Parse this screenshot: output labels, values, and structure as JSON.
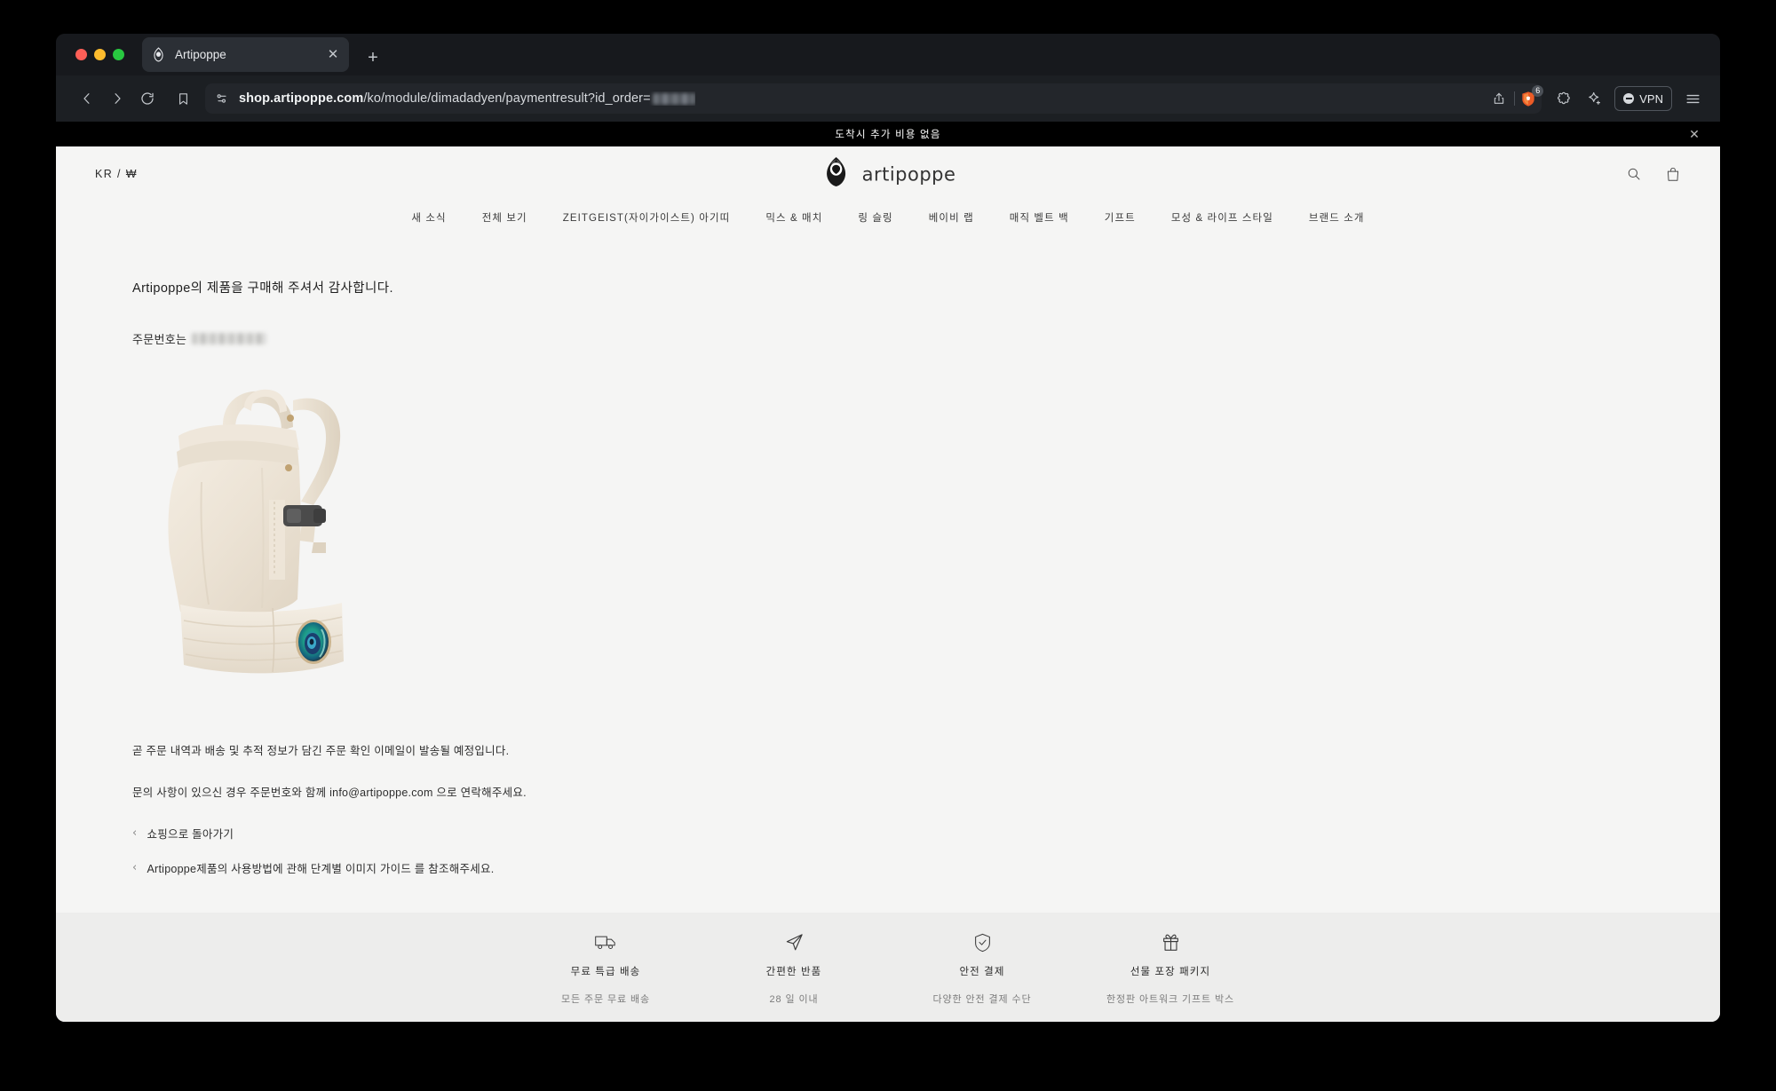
{
  "browser": {
    "tab": {
      "title": "Artipoppe",
      "favicon_icon": "artipoppe-logo-icon",
      "close_icon": "close-icon"
    },
    "new_tab_icon": "plus-icon",
    "nav": {
      "back_icon": "chevron-left-icon",
      "forward_icon": "chevron-right-icon",
      "reload_icon": "reload-icon",
      "bookmark_icon": "bookmark-icon"
    },
    "url": {
      "host": "shop.artipoppe.com",
      "path": "/ko/module/dimadadyen/paymentresult?id_order=",
      "redacted_value": "",
      "permissions_icon": "site-permissions-icon"
    },
    "actions": {
      "share_icon": "share-icon",
      "shield_icon": "brave-shield-icon",
      "shield_badge": "6",
      "extensions_icon": "extensions-puzzle-icon",
      "leo_icon": "leo-ai-star-icon",
      "vpn_label": "VPN",
      "vpn_icon": "vpn-toggle-icon",
      "menu_icon": "hamburger-menu-icon"
    }
  },
  "site": {
    "announcement": {
      "text": "도착시 추가 비용 없음",
      "close_icon": "close-icon"
    },
    "header": {
      "locale": "KR / ₩",
      "brand": "artipoppe",
      "logo_icon": "artipoppe-feather-logo-icon",
      "search_icon": "search-icon",
      "cart_icon": "shopping-bag-icon"
    },
    "nav_items": [
      {
        "label": "새 소식"
      },
      {
        "label": "전체 보기"
      },
      {
        "label": "ZEITGEIST(자이가이스트) 아기띠"
      },
      {
        "label": "믹스 & 매치"
      },
      {
        "label": "링 슬링"
      },
      {
        "label": "베이비 랩"
      },
      {
        "label": "매직 벨트 백"
      },
      {
        "label": "기프트"
      },
      {
        "label": "모성 & 라이프 스타일"
      },
      {
        "label": "브랜드 소개"
      }
    ],
    "content": {
      "thankyou": "Artipoppe의 제품을 구매해 주셔서 감사합니다.",
      "order_label": "주문번호는",
      "order_number": "",
      "product_image_alt": "cream baby carrier",
      "email_notice": "곧 주문 내역과 배송 및 추적 정보가 담긴 주문 확인 이메일이 발송될 예정입니다.",
      "contact_notice": "문의 사항이 있으신 경우 주문번호와 함께 info@artipoppe.com 으로 연락해주세요.",
      "links": [
        {
          "label": "쇼핑으로 돌아가기",
          "icon": "chevron-left-icon"
        },
        {
          "label": "Artipoppe제품의 사용방법에 관해 단계별 이미지 가이드 를 참조해주세요.",
          "icon": "chevron-left-icon"
        }
      ]
    },
    "usp": [
      {
        "icon": "delivery-truck-icon",
        "title": "무료 특급 배송",
        "sub": "모든 주문 무료 배송"
      },
      {
        "icon": "paper-plane-icon",
        "title": "간편한 반품",
        "sub": "28 일 이내"
      },
      {
        "icon": "shield-check-icon",
        "title": "안전 결제",
        "sub": "다양한 안전 결제 수단"
      },
      {
        "icon": "gift-box-icon",
        "title": "선물 포장 패키지",
        "sub": "한정판 아트워크 기프트 박스"
      }
    ]
  },
  "colors": {
    "page_bg": "#f5f5f4",
    "footer_bg": "#ededec",
    "announcement_bg": "#000000",
    "chrome_bg": "#1c1f23",
    "brand_ink": "#2c2c2c"
  }
}
